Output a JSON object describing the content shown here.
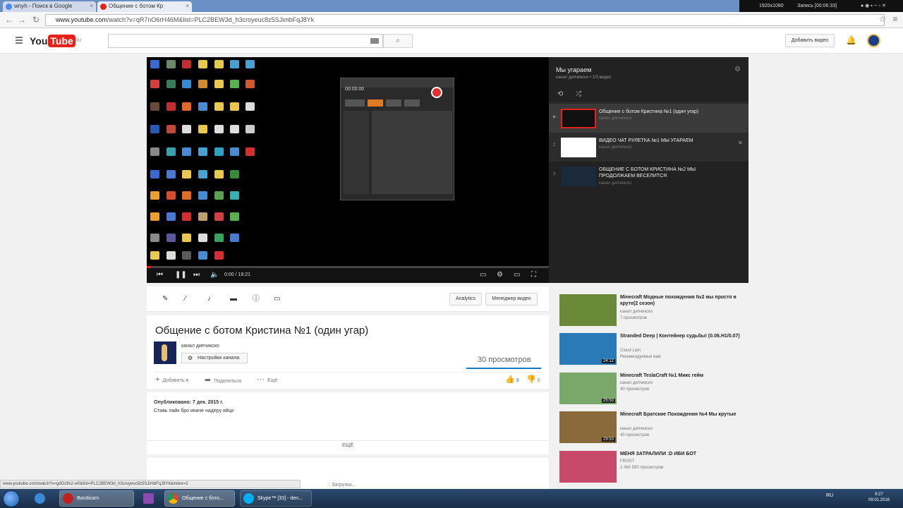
{
  "browser": {
    "tabs": [
      {
        "label": "wnyh - Поиск в Google",
        "active": false
      },
      {
        "label": "Общение с ботом Кр",
        "active": true
      }
    ],
    "recorder": {
      "resolution": "1920x1080",
      "status": "Запись [00:06:33]"
    },
    "url_host": "www.youtube.com",
    "url_path": "/watch?v=qR7nO6rH46M&list=PLC2BEW3d_h3croyeuc8z5SJimbFqJ8Yk"
  },
  "masthead": {
    "logo_you": "You",
    "logo_tube": "Tube",
    "logo_region": "RU",
    "upload_label": "Добавить видео",
    "search_icon": "magnifier",
    "bell_icon": "bell"
  },
  "player": {
    "bandicam_time": "00:00:00",
    "time_readout": "0:00 / 19:21",
    "progress_fraction": 0.01
  },
  "playlist": {
    "title": "Мы угараем",
    "subtitle": "канал дипчикско • 1/3 видео",
    "items": [
      {
        "index": "",
        "title": "Общение с ботом Кристина №1 (один угар)",
        "owner": "канал дипчикско"
      },
      {
        "index": "2",
        "title": "ВИДЕО ЧАТ РУЛЕТКА №1 МЫ УГАРАЕМ",
        "owner": "канал дипчикско"
      },
      {
        "index": "3",
        "title": "ОБЩЕНИЕ С БОТОМ КРИСТИНА №2 МЫ ПРОДОЛЖАЕМ ВЕСЕЛИТСЯ",
        "owner": "канал дипчикско"
      }
    ]
  },
  "creator_bar": {
    "analytics_label": "Analytics",
    "manager_label": "Менеджер видео"
  },
  "video": {
    "title": "Общение с ботом Кристина №1 (один угар)",
    "channel_name": "канал дипчикско",
    "channel_settings_label": "Настройки канала",
    "views": "30 просмотров",
    "add_to_label": "Добавить в",
    "share_label": "Поделиться",
    "more_label": "Ещё",
    "likes": "3",
    "dislikes": "0"
  },
  "description": {
    "published": "Опубликовано: 7 дек. 2015 г.",
    "text": "Ставь лайк бро иначе надеру яйцо",
    "more_label": "ЕЩЁ"
  },
  "comments": {
    "loading_label": "Загрузка..."
  },
  "recommendations": [
    {
      "title": "Minecraft Модные похождения №2 мы просто в крутe(2 сезон)",
      "owner": "канал дипчикско",
      "views": "7 просмотров",
      "duration": "",
      "thumb_color": "#6a8a3a"
    },
    {
      "title": "Stranded Deep | Контейнер судьбы! (0.06.H1/0.07)",
      "owner": "Cloud Lam",
      "views": "Рекомендуемые вам",
      "duration": "24:12",
      "thumb_color": "#2a7ab8"
    },
    {
      "title": "Minecraft TeslaCraft №1 Микс гейм",
      "owner": "канал дипчикско",
      "views": "40 просмотров",
      "duration": "25:50",
      "thumb_color": "#7aa86a"
    },
    {
      "title": "Minecraft Братские Похождения №4 Мы крутые",
      "owner": "канал дипчикско",
      "views": "40 просмотров",
      "duration": "29:53",
      "thumb_color": "#8a6a3a"
    },
    {
      "title": "МЕНЯ ЗАТРАЛИЛИ :D ИВИ БОТ",
      "owner": "FROST",
      "views": "2 460 590 просмотров",
      "duration": "",
      "thumb_color": "#c84a6a"
    }
  ],
  "status_url": "www.youtube.com/watch?v=gdOz9s2-w0&list=PLC2BEW3d_h3croyeuc8z5SJimbFqJ8Yk&index=2",
  "taskbar": {
    "items": [
      {
        "label": "Bandicam"
      },
      {
        "label": "Общение с бото..."
      },
      {
        "label": "Skype™ [33] - den..."
      }
    ],
    "lang": "RU",
    "time": "9:27",
    "date": "09.01.2016"
  }
}
